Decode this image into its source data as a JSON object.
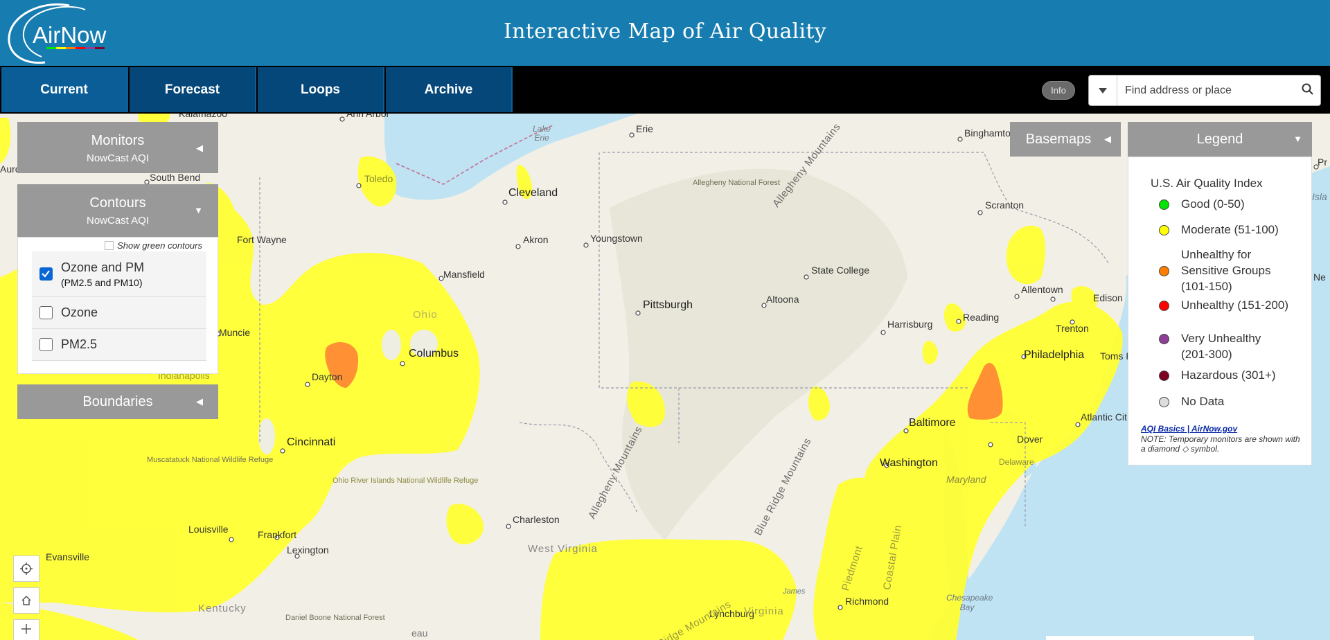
{
  "header": {
    "logo_text": "AirNow",
    "title": "Interactive Map of Air Quality"
  },
  "nav": {
    "tabs": [
      {
        "label": "Current",
        "active": true
      },
      {
        "label": "Forecast",
        "active": false
      },
      {
        "label": "Loops",
        "active": false
      },
      {
        "label": "Archive",
        "active": false
      }
    ],
    "info_label": "Info",
    "search_placeholder": "Find address or place"
  },
  "panels": {
    "monitors": {
      "title": "Monitors",
      "subtitle": "NowCast AQI"
    },
    "contours": {
      "title": "Contours",
      "subtitle": "NowCast AQI",
      "show_green_label": "Show green contours",
      "show_green_checked": false,
      "options": [
        {
          "label": "Ozone and PM",
          "sublabel": "(PM2.5 and PM10)",
          "checked": true
        },
        {
          "label": "Ozone",
          "sublabel": "",
          "checked": false
        },
        {
          "label": "PM2.5",
          "sublabel": "",
          "checked": false
        }
      ]
    },
    "boundaries": {
      "title": "Boundaries"
    },
    "basemaps": {
      "title": "Basemaps"
    }
  },
  "legend": {
    "title": "Legend",
    "index_title": "U.S. Air Quality Index",
    "items": [
      {
        "label": "Good (0-50)",
        "color": "#00e400"
      },
      {
        "label": "Moderate (51-100)",
        "color": "#ffff00"
      },
      {
        "label": "Unhealthy for Sensitive Groups (101-150)",
        "color": "#ff7e00"
      },
      {
        "label": "Unhealthy (151-200)",
        "color": "#ff0000"
      },
      {
        "label": "Very Unhealthy (201-300)",
        "color": "#8f3f97"
      },
      {
        "label": "Hazardous (301+)",
        "color": "#7e0023"
      },
      {
        "label": "No Data",
        "color": "#dddddd"
      }
    ],
    "link_text": "AQI Basics | AirNow.gov",
    "note": "NOTE: Temporary monitors are shown with a diamond ◇ symbol."
  },
  "map": {
    "labels": {
      "kalamazoo": "Kalamazoo",
      "ann_arbor": "Ann Arbor",
      "erie": "Erie",
      "binghamton": "Binghamton",
      "lake_erie": "Lake Erie",
      "south_bend": "South Bend",
      "toledo": "Toledo",
      "cleveland": "Cleveland",
      "allegheny_nf": "Allegheny National Forest",
      "allegheny_mts_ne": "Allegheny Mountains",
      "scranton": "Scranton",
      "aurora": "Aurora",
      "fort_wayne": "Fort Wayne",
      "akron": "Akron",
      "youngstown": "Youngstown",
      "mansfield": "Mansfield",
      "state_college": "State College",
      "allentown": "Allentown",
      "ohio": "Ohio",
      "pittsburgh": "Pittsburgh",
      "altoona": "Altoona",
      "harrisburg": "Harrisburg",
      "reading": "Reading",
      "edison": "Edison",
      "trenton": "Trenton",
      "muncie": "Muncie",
      "columbus": "Columbus",
      "philadelphia": "Philadelphia",
      "toms_river": "Toms R",
      "indianapolis": "Indianapolis",
      "dayton": "Dayton",
      "baltimore": "Baltimore",
      "dover": "Dover",
      "atlantic_city": "Atlantic Cit",
      "cincinnati": "Cincinnati",
      "muscatatuck": "Muscatatuck National Wildlife Refuge",
      "allegheny_mts_sw": "Allegheny Mountains",
      "blue_ridge": "Blue Ridge Mountains",
      "washington": "Washington",
      "delaware": "Delaware",
      "maryland": "Maryland",
      "ohio_river": "Ohio River Islands National Wildlife Refuge",
      "charleston": "Charleston",
      "piedmont": "Piedmont",
      "coastal_plain": "Coastal Plain",
      "louisville": "Louisville",
      "frankfort": "Frankfort",
      "west_virginia": "West Virginia",
      "evansville": "Evansville",
      "lexington": "Lexington",
      "richmond": "Richmond",
      "chesapeake_bay": "Chesapeake Bay",
      "james": "James",
      "kentucky": "Kentucky",
      "lynchburg": "Lynchburg",
      "virginia": "Virginia",
      "daniel_boone": "Daniel Boone National Forest",
      "ridge_south": "Ridge Mountains",
      "plateau": "eau",
      "ne": "Ne",
      "pr": "Pr",
      "isla": "Isla"
    }
  }
}
